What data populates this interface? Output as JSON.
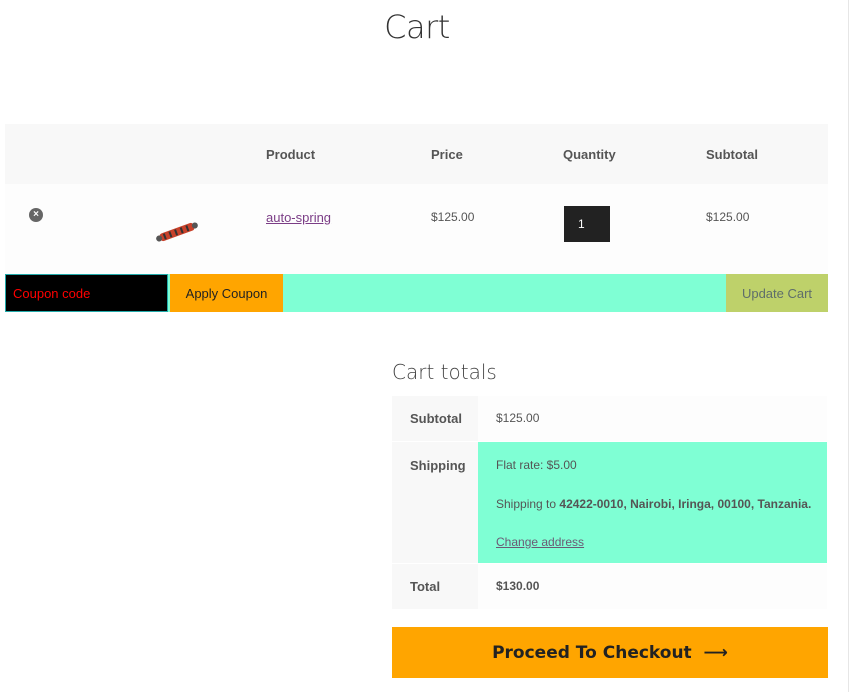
{
  "page": {
    "title": "Cart"
  },
  "table": {
    "headers": {
      "product": "Product",
      "price": "Price",
      "quantity": "Quantity",
      "subtotal": "Subtotal"
    },
    "row": {
      "remove": "×",
      "product_name": "auto-spring",
      "price": "$125.00",
      "quantity": "1",
      "subtotal": "$125.00"
    }
  },
  "actions": {
    "coupon_placeholder": "Coupon code",
    "apply_label": "Apply Coupon",
    "update_label": "Update Cart"
  },
  "totals": {
    "title": "Cart totals",
    "subtotal_label": "Subtotal",
    "subtotal_value": "$125.00",
    "shipping_label": "Shipping",
    "shipping_rate": "Flat rate: $5.00",
    "shipping_to_prefix": "Shipping to ",
    "shipping_address": "42422-0010, Nairobi, Iringa, 00100, Tanzania.",
    "change_address": "Change address",
    "total_label": "Total",
    "total_value": "$130.00"
  },
  "checkout": {
    "label": "Proceed To Checkout",
    "arrow": "⟶"
  },
  "colors": {
    "accent_orange": "#ffa500",
    "aquamarine": "#7fffd4",
    "update_green": "#bed16a"
  }
}
